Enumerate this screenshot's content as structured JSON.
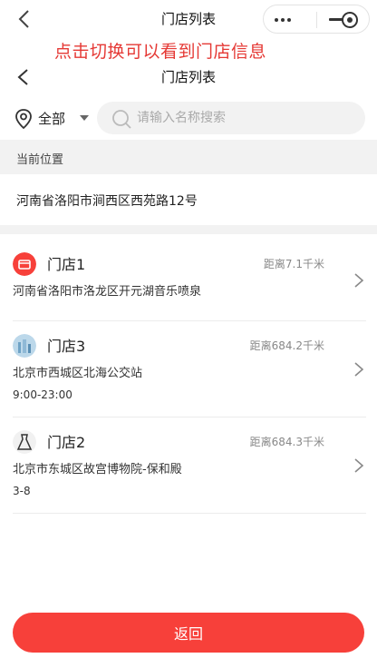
{
  "top_nav": {
    "title": "门店列表"
  },
  "hint": "点击切换可以看到门店信息",
  "page_header": {
    "title": "门店列表"
  },
  "filter": {
    "region": "全部"
  },
  "search": {
    "placeholder": "请输入名称搜索",
    "value": ""
  },
  "current_location": {
    "label": "当前位置",
    "address": "河南省洛阳市涧西区西苑路12号"
  },
  "stores": [
    {
      "name": "门店1",
      "distance": "距离7.1千米",
      "address": "河南省洛阳市洛龙区开元湖音乐喷泉",
      "hours": "",
      "icon": "store-front-icon"
    },
    {
      "name": "门店3",
      "distance": "距离684.2千米",
      "address": "北京市西城区北海公交站",
      "hours": "9:00-23:00",
      "icon": "store-photo-icon"
    },
    {
      "name": "门店2",
      "distance": "距离684.3千米",
      "address": "北京市东城区故宫博物院-保和殿",
      "hours": "3-8",
      "icon": "dress-icon"
    }
  ],
  "return_button": "返回",
  "colors": {
    "accent": "#f7403a",
    "hint": "#e53935",
    "divider_bg": "#f2f2f2"
  }
}
